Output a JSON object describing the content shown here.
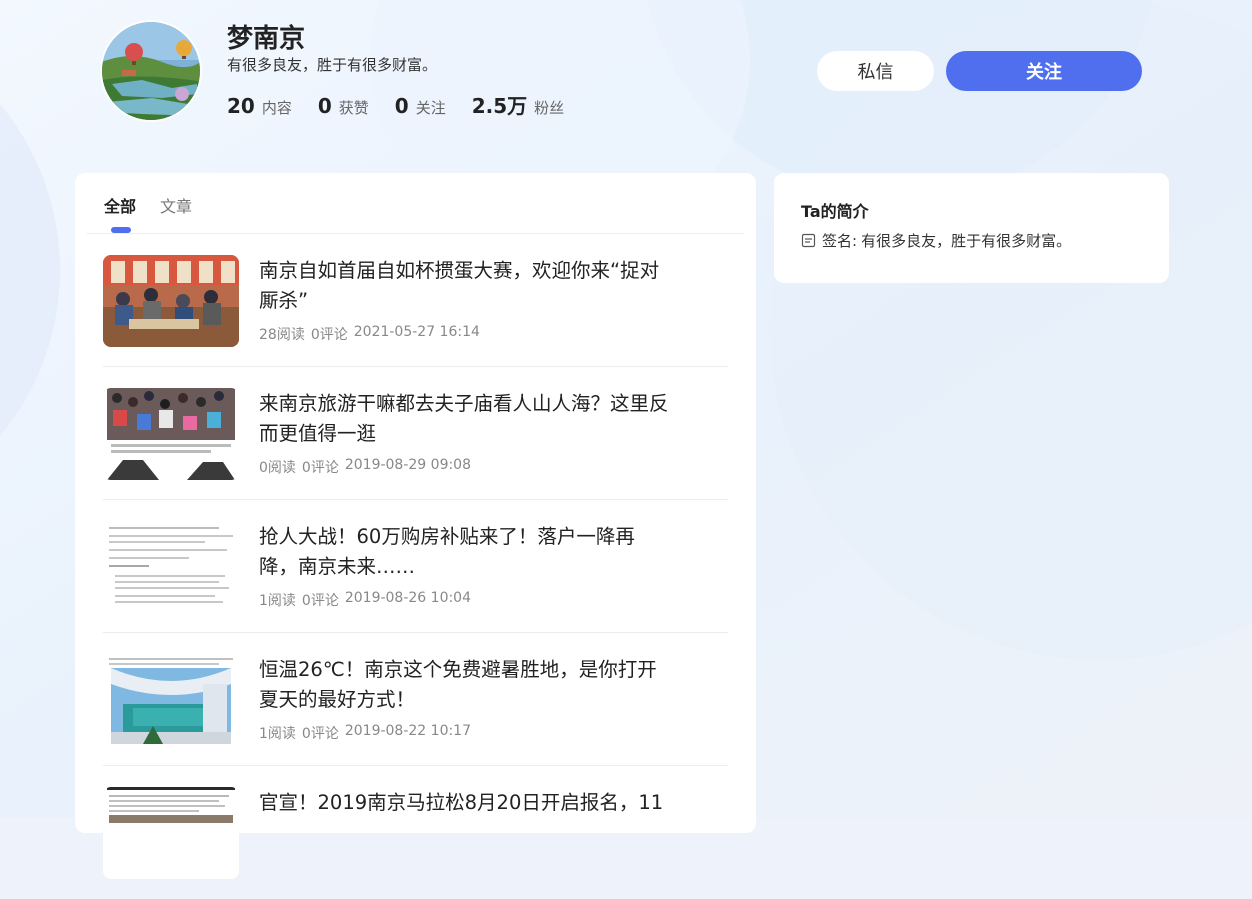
{
  "profile": {
    "name": "梦南京",
    "bio": "有很多良友，胜于有很多财富。",
    "stats": [
      {
        "num": "20",
        "label": "内容"
      },
      {
        "num": "0",
        "label": "获赞"
      },
      {
        "num": "0",
        "label": "关注"
      },
      {
        "num": "2.5万",
        "label": "粉丝"
      }
    ],
    "message_label": "私信",
    "follow_label": "关注"
  },
  "tabs": [
    {
      "label": "全部",
      "active": true
    },
    {
      "label": "文章",
      "active": false
    }
  ],
  "articles": [
    {
      "title": "南京自如首届自如杯掼蛋大赛，欢迎你来“捉对厮杀”",
      "reads": "28阅读",
      "comments": "0评论",
      "time": "2021-05-27 16:14"
    },
    {
      "title": "来南京旅游干嘛都去夫子庙看人山人海？这里反而更值得一逛",
      "reads": "0阅读",
      "comments": "0评论",
      "time": "2019-08-29 09:08"
    },
    {
      "title": "抢人大战！60万购房补贴来了！落户一降再降，南京未来……",
      "reads": "1阅读",
      "comments": "0评论",
      "time": "2019-08-26 10:04"
    },
    {
      "title": "恒温26℃！南京这个免费避暑胜地，是你打开夏天的最好方式！",
      "reads": "1阅读",
      "comments": "0评论",
      "time": "2019-08-22 10:17"
    },
    {
      "title": "官宣！2019南京马拉松8月20日开启报名，11",
      "reads": "",
      "comments": "",
      "time": ""
    }
  ],
  "sidebar": {
    "title": "Ta的简介",
    "sign_key": "签名:",
    "sign_value": "有很多良友，胜于有很多财富。"
  },
  "colors": {
    "accent": "#4f6fee",
    "background": "#eef3fb"
  }
}
